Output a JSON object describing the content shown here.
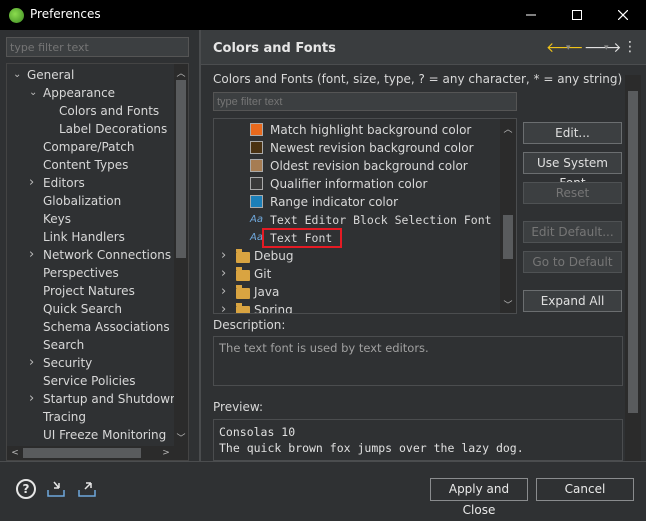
{
  "window": {
    "title": "Preferences"
  },
  "left": {
    "filter_placeholder": "type filter text",
    "tree": [
      {
        "label": "General",
        "level": 0,
        "expander": "open"
      },
      {
        "label": "Appearance",
        "level": 1,
        "expander": "open"
      },
      {
        "label": "Colors and Fonts",
        "level": 2,
        "expander": "none"
      },
      {
        "label": "Label Decorations",
        "level": 2,
        "expander": "none"
      },
      {
        "label": "Compare/Patch",
        "level": 1,
        "expander": "none"
      },
      {
        "label": "Content Types",
        "level": 1,
        "expander": "none"
      },
      {
        "label": "Editors",
        "level": 1,
        "expander": "closed"
      },
      {
        "label": "Globalization",
        "level": 1,
        "expander": "none"
      },
      {
        "label": "Keys",
        "level": 1,
        "expander": "none"
      },
      {
        "label": "Link Handlers",
        "level": 1,
        "expander": "none"
      },
      {
        "label": "Network Connections",
        "level": 1,
        "expander": "closed"
      },
      {
        "label": "Perspectives",
        "level": 1,
        "expander": "none"
      },
      {
        "label": "Project Natures",
        "level": 1,
        "expander": "none"
      },
      {
        "label": "Quick Search",
        "level": 1,
        "expander": "none"
      },
      {
        "label": "Schema Associations",
        "level": 1,
        "expander": "none"
      },
      {
        "label": "Search",
        "level": 1,
        "expander": "none"
      },
      {
        "label": "Security",
        "level": 1,
        "expander": "closed"
      },
      {
        "label": "Service Policies",
        "level": 1,
        "expander": "none"
      },
      {
        "label": "Startup and Shutdown",
        "level": 1,
        "expander": "closed"
      },
      {
        "label": "Tracing",
        "level": 1,
        "expander": "none"
      },
      {
        "label": "UI Freeze Monitoring",
        "level": 1,
        "expander": "none"
      }
    ]
  },
  "right": {
    "title": "Colors and Fonts",
    "caption": "Colors and Fonts (font, size, type, ? = any character, * = any string) :",
    "filter_placeholder": "type filter text",
    "items": [
      {
        "label": "Match highlight background color",
        "kind": "color",
        "color": "#e8691d"
      },
      {
        "label": "Newest revision background color",
        "kind": "color",
        "color": "#4a3212"
      },
      {
        "label": "Oldest revision background color",
        "kind": "color",
        "color": "#a67c52"
      },
      {
        "label": "Qualifier information color",
        "kind": "color",
        "color": "#3a3a3a"
      },
      {
        "label": "Range indicator color",
        "kind": "color",
        "color": "#1c7fb8"
      },
      {
        "label": "Text Editor Block Selection Font",
        "kind": "font"
      },
      {
        "label": "Text Font",
        "kind": "font-selected"
      },
      {
        "label": "Debug",
        "kind": "folder"
      },
      {
        "label": "Git",
        "kind": "folder"
      },
      {
        "label": "Java",
        "kind": "folder"
      },
      {
        "label": "Spring",
        "kind": "folder"
      }
    ],
    "buttons": {
      "edit": "Edit...",
      "use_system_font": "Use System Font",
      "reset": "Reset",
      "edit_default": "Edit Default...",
      "go_to_default": "Go to Default",
      "expand_all": "Expand All"
    },
    "description_label": "Description:",
    "description_text": "The text font is used by text editors.",
    "preview_label": "Preview:",
    "preview_lines": [
      "Consolas 10",
      "The quick brown fox jumps over the lazy dog."
    ]
  },
  "bottom": {
    "apply_close": "Apply and Close",
    "cancel": "Cancel"
  },
  "colors": {
    "selection_border": "#e51b24",
    "nav_back": "#f0c419"
  }
}
